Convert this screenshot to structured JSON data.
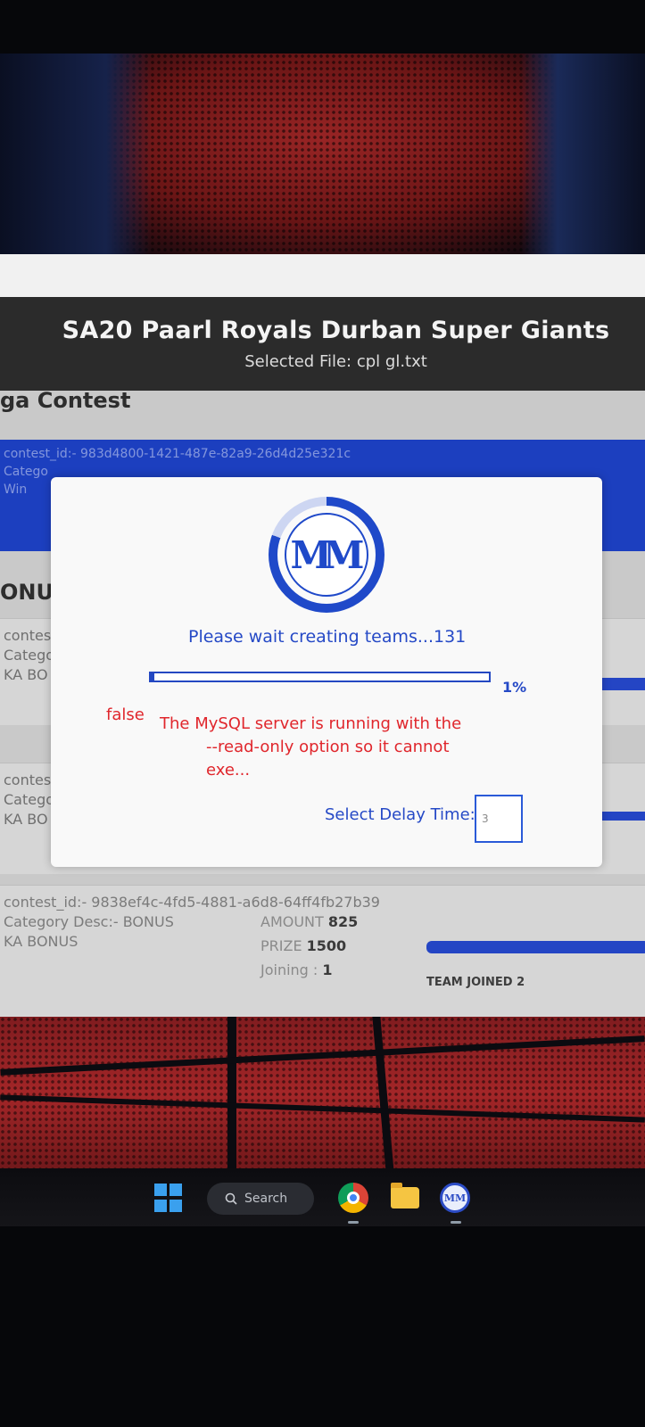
{
  "window": {
    "title": "SA20 Paarl Royals Durban Super Giants",
    "selected_file": "Selected File: cpl gl.txt"
  },
  "sections": {
    "mega_title": "ga Contest",
    "bonus_title": "ONUS"
  },
  "contests": [
    {
      "id_line": "contest_id:- 983d4800-1421-487e-82a9-26d4d25e321c",
      "category": "Catego",
      "extra": "Win"
    },
    {
      "id_line": "contes",
      "category": "Catego",
      "extra": "KA BO"
    },
    {
      "id_line": "contes",
      "category": "Catego",
      "extra": "KA BO"
    },
    {
      "id_line": "contest_id:- 9838ef4c-4fd5-4881-a6d8-64ff4fb27b39",
      "category": "Category Desc:- BONUS",
      "extra": "KA BONUS",
      "amount_label": "AMOUNT",
      "amount": "825",
      "prize_label": "PRIZE",
      "prize": "1500",
      "joining_label": "Joining :",
      "joining": "1",
      "team_joined": "TEAM JOINED 2"
    }
  ],
  "modal": {
    "logo_text": "MM",
    "wait_text": "Please wait creating teams...131",
    "progress_percent": 1,
    "progress_label": "1%",
    "error_flag": "false",
    "error_line1": "The MySQL server is running with the",
    "error_line2": "--read-only option so it cannot exe...",
    "delay_label": "Select Delay Time:",
    "delay_value": "3"
  },
  "taskbar": {
    "search_label": "Search",
    "icons": [
      "windows-start-icon",
      "search-icon",
      "chrome-icon",
      "file-explorer-icon",
      "mm-app-icon"
    ]
  },
  "colors": {
    "accent_blue": "#2448c2",
    "error_red": "#e0262c",
    "header_dark": "#2b2b2b"
  }
}
